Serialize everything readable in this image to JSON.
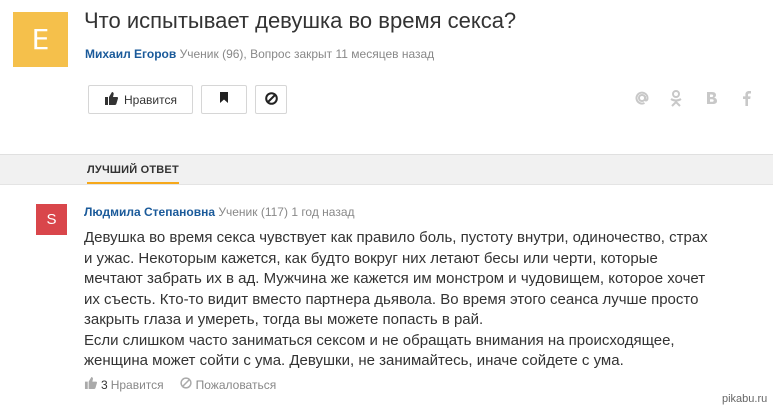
{
  "question": {
    "avatar_letter": "E",
    "title": "Что испытывает девушка во время секса?",
    "author": "Михаил Егоров",
    "meta": "Ученик (96), Вопрос закрыт 11 месяцев назад"
  },
  "actions": {
    "like_label": "Нравится"
  },
  "share_icons": [
    "at-icon",
    "odnoklassniki-icon",
    "vk-icon",
    "facebook-icon"
  ],
  "tabs": {
    "best_answer": "ЛУЧШИЙ ОТВЕТ"
  },
  "answer": {
    "avatar_letter": "S",
    "author": "Людмила Степановна",
    "rank": "Ученик (117)",
    "time": "1 год назад",
    "lines": [
      "Девушка во время секса чувствует как правило боль, пустоту внутри, одиночество, страх",
      "и ужас. Некоторым кажется, как будто вокруг них летают бесы или черти, которые",
      "мечтают забрать их в ад. Мужчина же кажется им монстром и чудовищем, которое хочет",
      "их съесть. Кто-то видит вместо партнера дьявола. Во время этого сеанса лучше просто",
      "закрыть глаза и умереть, тогда вы можете попасть в рай.",
      "Если слишком часто заниматься сексом и не обращать внимания на происходящее,",
      "женщина может сойти с ума. Девушки, не занимайтесь, иначе сойдете с ума."
    ],
    "like_count": "3",
    "like_label": "Нравится",
    "report_label": "Пожаловаться"
  },
  "watermark": "pikabu.ru",
  "colors": {
    "question_avatar": "#f5c04b",
    "answer_avatar": "#d9464b",
    "author_link": "#1a5a9a",
    "tab_underline": "#f6a81a"
  }
}
